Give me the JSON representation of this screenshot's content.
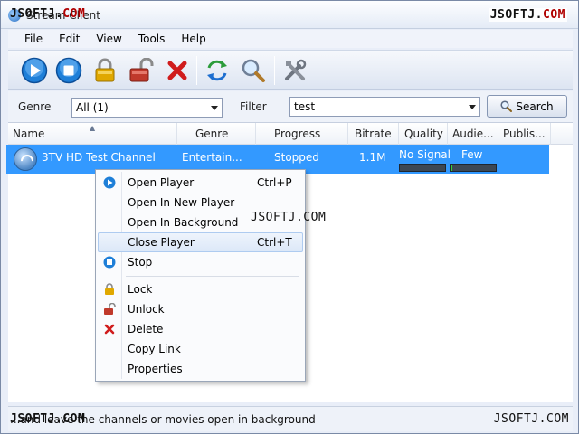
{
  "window": {
    "title": "Stream Client",
    "watermark_prefix": "JSOFTJ.",
    "watermark_suffix": "COM",
    "watermark_full": "JSOFTJ.COM"
  },
  "menu": [
    "File",
    "Edit",
    "View",
    "Tools",
    "Help"
  ],
  "toolbar": {
    "icons": [
      "play-icon",
      "stop-icon",
      "lock-icon",
      "unlock-icon",
      "delete-icon",
      "refresh-icon",
      "search-icon",
      "tools-icon"
    ]
  },
  "filter": {
    "genre_label": "Genre",
    "genre_value": "All (1)",
    "filter_label": "Filter",
    "filter_value": "test",
    "search_label": "Search"
  },
  "columns": [
    "Name",
    "Genre",
    "Progress",
    "Bitrate",
    "Quality",
    "Audie...",
    "Publis..."
  ],
  "channel": {
    "name": "3TV HD Test Channel",
    "genre": "Entertain...",
    "progress": "Stopped",
    "bitrate": "1.1M",
    "quality": "No Signal",
    "quality_level": 0,
    "audience": "Few",
    "audience_level": 0.04,
    "publisher": ""
  },
  "context_menu": {
    "items": [
      {
        "label": "Open Player",
        "shortcut": "Ctrl+P",
        "icon": "play-icon"
      },
      {
        "label": "Open In New Player",
        "shortcut": "",
        "icon": ""
      },
      {
        "label": "Open In Background",
        "shortcut": "",
        "icon": ""
      },
      {
        "label": "Close Player",
        "shortcut": "Ctrl+T",
        "icon": ""
      },
      {
        "label": "Stop",
        "shortcut": "",
        "icon": "stop-icon"
      },
      {
        "label": "Lock",
        "shortcut": "",
        "icon": "lock-icon"
      },
      {
        "label": "Unlock",
        "shortcut": "",
        "icon": "unlock-icon"
      },
      {
        "label": "Delete",
        "shortcut": "",
        "icon": "delete-icon"
      },
      {
        "label": "Copy Link",
        "shortcut": "",
        "icon": ""
      },
      {
        "label": "Properties",
        "shortcut": "",
        "icon": ""
      }
    ],
    "highlighted": "Close Player"
  },
  "status": {
    "text": "...and leave the channels or movies open in background"
  },
  "colors": {
    "selection": "#3399ff",
    "watermark_red": "#b00000",
    "play_blue": "#1e7fd8",
    "lock_gold": "#e0a800",
    "unlock_red": "#c0392b",
    "delete_red": "#d01c1c"
  }
}
